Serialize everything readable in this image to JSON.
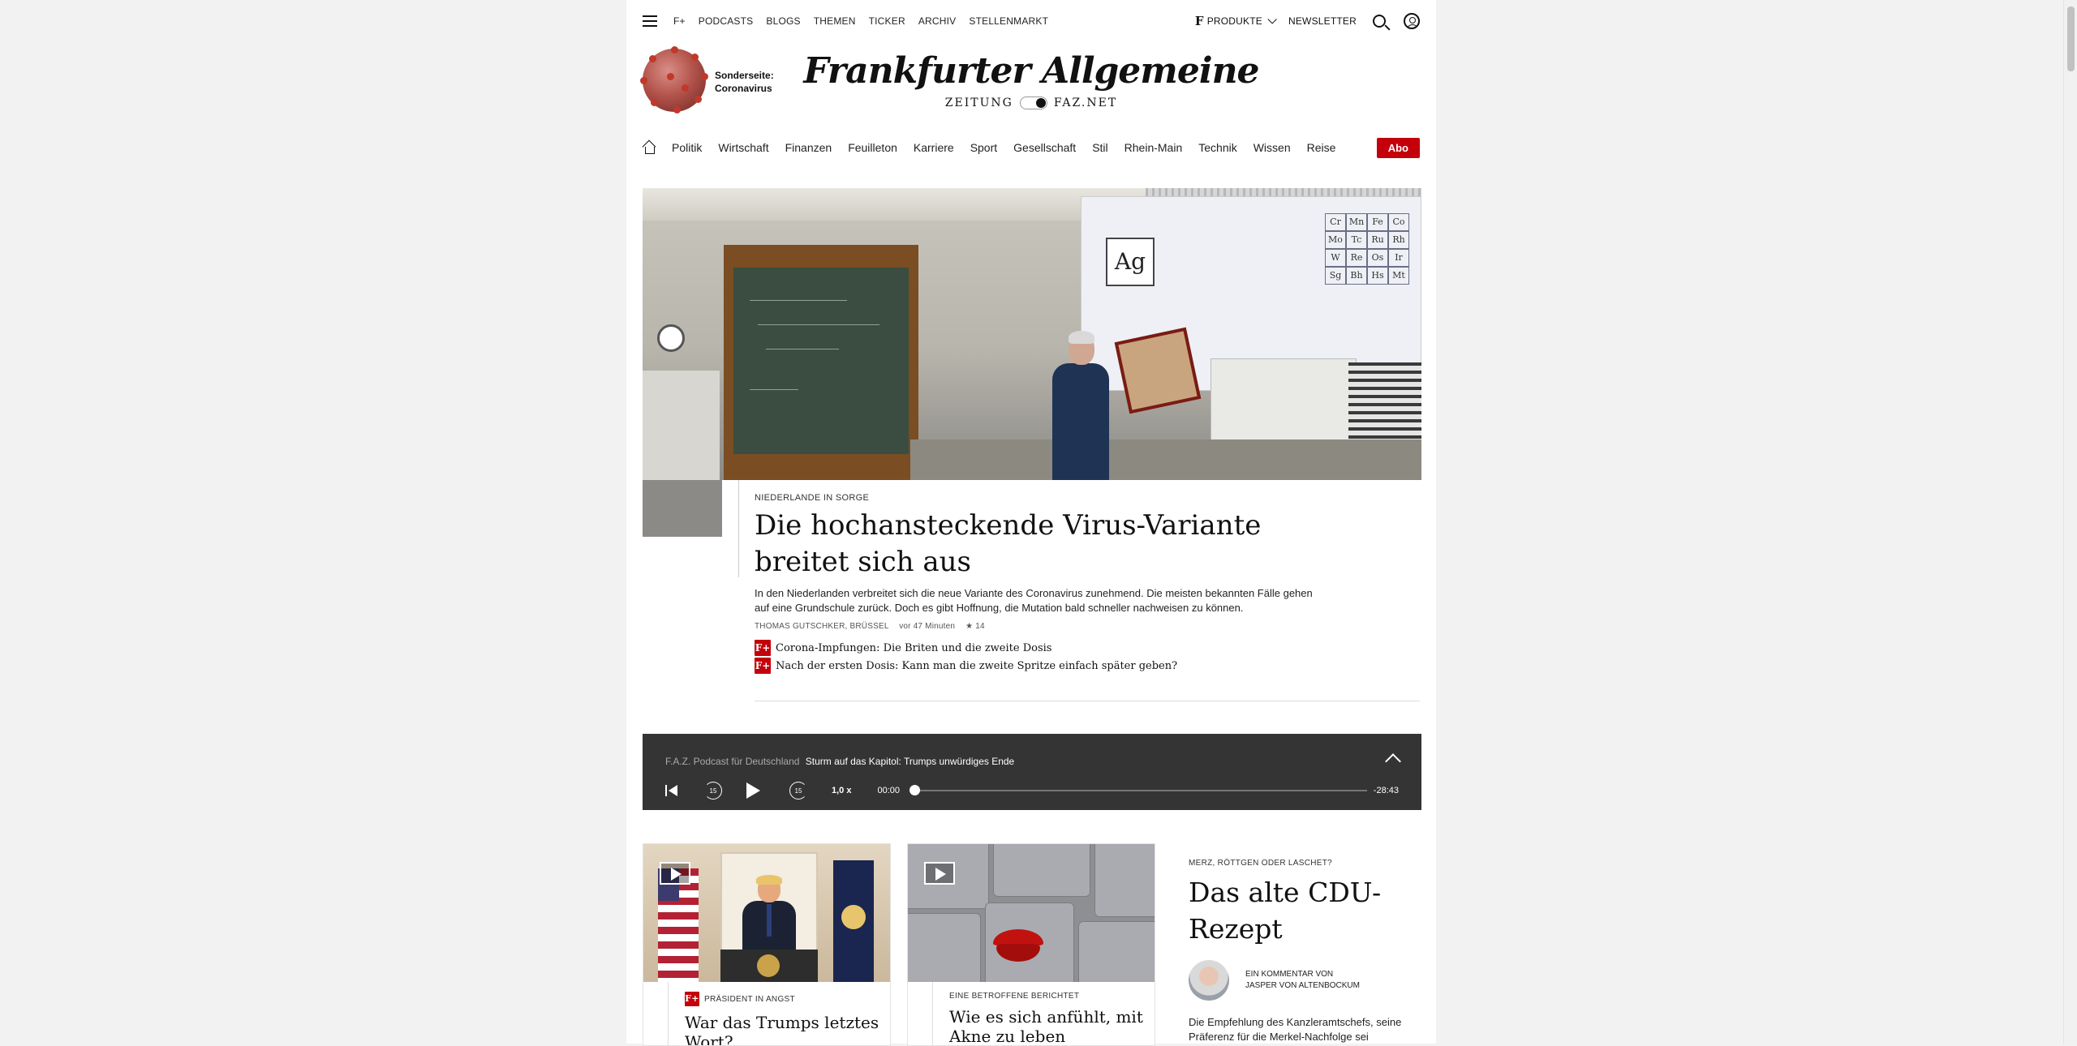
{
  "topbar": {
    "links": [
      "F+",
      "PODCASTS",
      "BLOGS",
      "THEMEN",
      "TICKER",
      "ARCHIV",
      "STELLENMARKT"
    ],
    "produkte": "PRODUKTE",
    "newsletter": "NEWSLETTER"
  },
  "masthead": {
    "special_label_1": "Sonderseite:",
    "special_label_2": "Coronavirus",
    "logo_name": "Frankfurter Allgemeine",
    "logo_left": "ZEITUNG",
    "logo_right": "FAZ.NET"
  },
  "mainnav": {
    "items": [
      "Politik",
      "Wirtschaft",
      "Finanzen",
      "Feuilleton",
      "Karriere",
      "Sport",
      "Gesellschaft",
      "Stil",
      "Rhein-Main",
      "Technik",
      "Wissen",
      "Reise"
    ],
    "abo": "Abo"
  },
  "hero": {
    "kicker": "NIEDERLANDE IN SORGE",
    "headline": "Die hochansteckende Virus-Variante breitet sich aus",
    "description": "In den Niederlanden verbreitet sich die neue Variante des Coronavirus zunehmend. Die meisten bekannten Fälle gehen auf eine Grundschule zurück. Doch es gibt Hoffnung, die Mutation bald schneller nachweisen zu können.",
    "author": "THOMAS GUTSCHKER, BRÜSSEL",
    "time": "vor 47 Minuten",
    "stars": "★ 14",
    "related": [
      "Corona-Impfungen: Die Briten und die zweite Dosis",
      "Nach der ersten Dosis: Kann man die zweite Spritze einfach später geben?"
    ]
  },
  "player": {
    "series": "F.A.Z. Podcast für Deutschland",
    "episode": "Sturm auf das Kapitol: Trumps unwürdiges Ende",
    "skip_back": "15",
    "skip_fwd": "15",
    "speed": "1,0 x",
    "current_time": "00:00",
    "remaining_time": "-28:43",
    "progress": 0
  },
  "cards": [
    {
      "kicker": "PRÄSIDENT IN ANGST",
      "headline": "War das Trumps letztes Wort?",
      "plus": true
    },
    {
      "kicker": "EINE BETROFFENE BERICHTET",
      "headline": "Wie es sich anfühlt, mit Akne zu leben",
      "plus": false
    }
  ],
  "commentary": {
    "kicker": "MERZ, RÖTTGEN ODER LASCHET?",
    "headline": "Das alte CDU-Rezept",
    "author_line1": "EIN KOMMENTAR VON",
    "author_line2": "JASPER VON ALTENBOCKUM",
    "description": "Die Empfehlung des Kanzleramtschefs, seine Präferenz für die Merkel-Nachfolge sei"
  },
  "colors": {
    "brand_red": "#c4000b",
    "player_bg": "#343434"
  },
  "icons": [
    "menu-icon",
    "search-icon",
    "user-icon",
    "home-icon",
    "chevron-down-icon",
    "play-icon",
    "video-icon"
  ]
}
